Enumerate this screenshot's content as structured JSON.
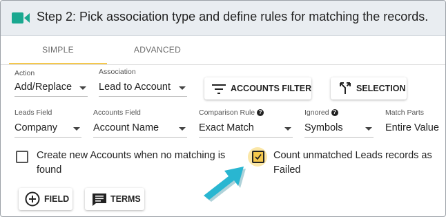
{
  "header": {
    "title": "Step 2: Pick association type and define rules for matching the records.",
    "icon": "video-camera-icon",
    "accent": "#1aa890"
  },
  "tabs": [
    {
      "label": "SIMPLE",
      "active": true
    },
    {
      "label": "ADVANCED",
      "active": false
    }
  ],
  "row1": {
    "action": {
      "label": "Action",
      "value": "Add/Replace"
    },
    "association": {
      "label": "Association",
      "value": "Lead to Account"
    },
    "accounts_filter_btn": "ACCOUNTS FILTER",
    "selection_btn": "SELECTION"
  },
  "row2": {
    "leads_field": {
      "label": "Leads Field",
      "value": "Company"
    },
    "accounts_field": {
      "label": "Accounts Field",
      "value": "Account Name"
    },
    "comparison_rule": {
      "label": "Comparison Rule",
      "value": "Exact Match"
    },
    "ignored": {
      "label": "Ignored",
      "value": "Symbols"
    },
    "match_parts": {
      "label": "Match Parts",
      "value": "Entire Value"
    }
  },
  "checkboxes": {
    "create_accounts": {
      "line1": "Create new Accounts when no matching is",
      "line2": "found",
      "checked": false
    },
    "count_unmatched": {
      "line1": "Count unmatched Leads records as",
      "line2": "Failed",
      "checked": true
    }
  },
  "buttons": {
    "field": "FIELD",
    "terms": "TERMS"
  },
  "colors": {
    "tab_underline": "#f5c84c",
    "arrow": "#29b6d1",
    "checkbox_checked": "#f5c84c"
  }
}
